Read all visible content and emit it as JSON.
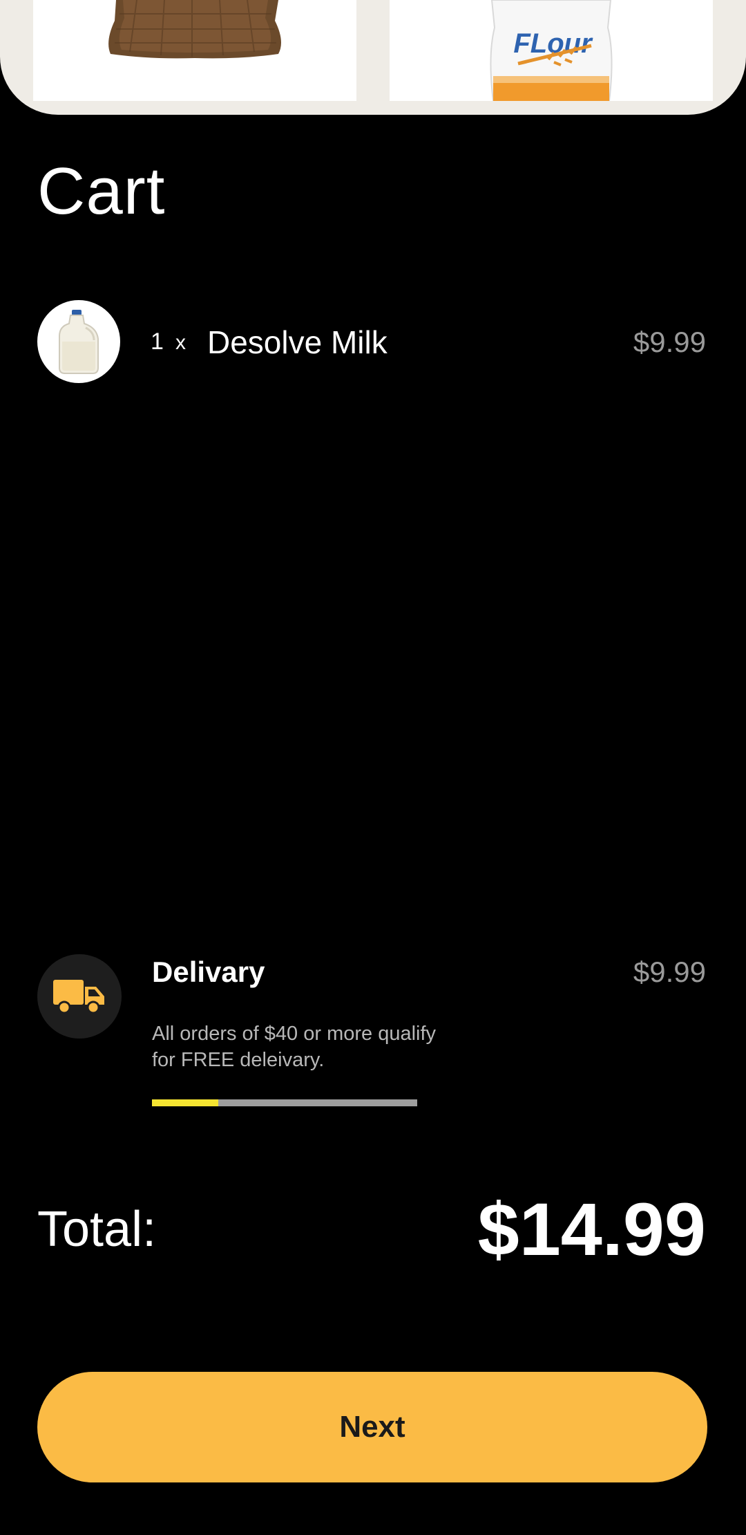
{
  "products_strip": [
    {
      "icon": "sack-icon"
    },
    {
      "icon": "flour-bag-icon",
      "label": "FLour"
    }
  ],
  "cart": {
    "title": "Cart",
    "items": [
      {
        "quantity": "1",
        "times": "x",
        "name": "Desolve Milk",
        "price": "$9.99",
        "icon": "milk-jug-icon"
      }
    ]
  },
  "delivery": {
    "title": "Delivary",
    "price": "$9.99",
    "note": "All orders of $40 or more qualify for FREE deleivary.",
    "progress_fraction": 0.25,
    "icon": "truck-icon"
  },
  "total": {
    "label": "Total:",
    "value": "$14.99"
  },
  "actions": {
    "next_label": "Next"
  },
  "colors": {
    "accent": "#fbbb45",
    "progress_fill": "#f5e431",
    "progress_track": "#9e9e9e",
    "background": "#000000",
    "muted_text": "#9a9a9a"
  }
}
